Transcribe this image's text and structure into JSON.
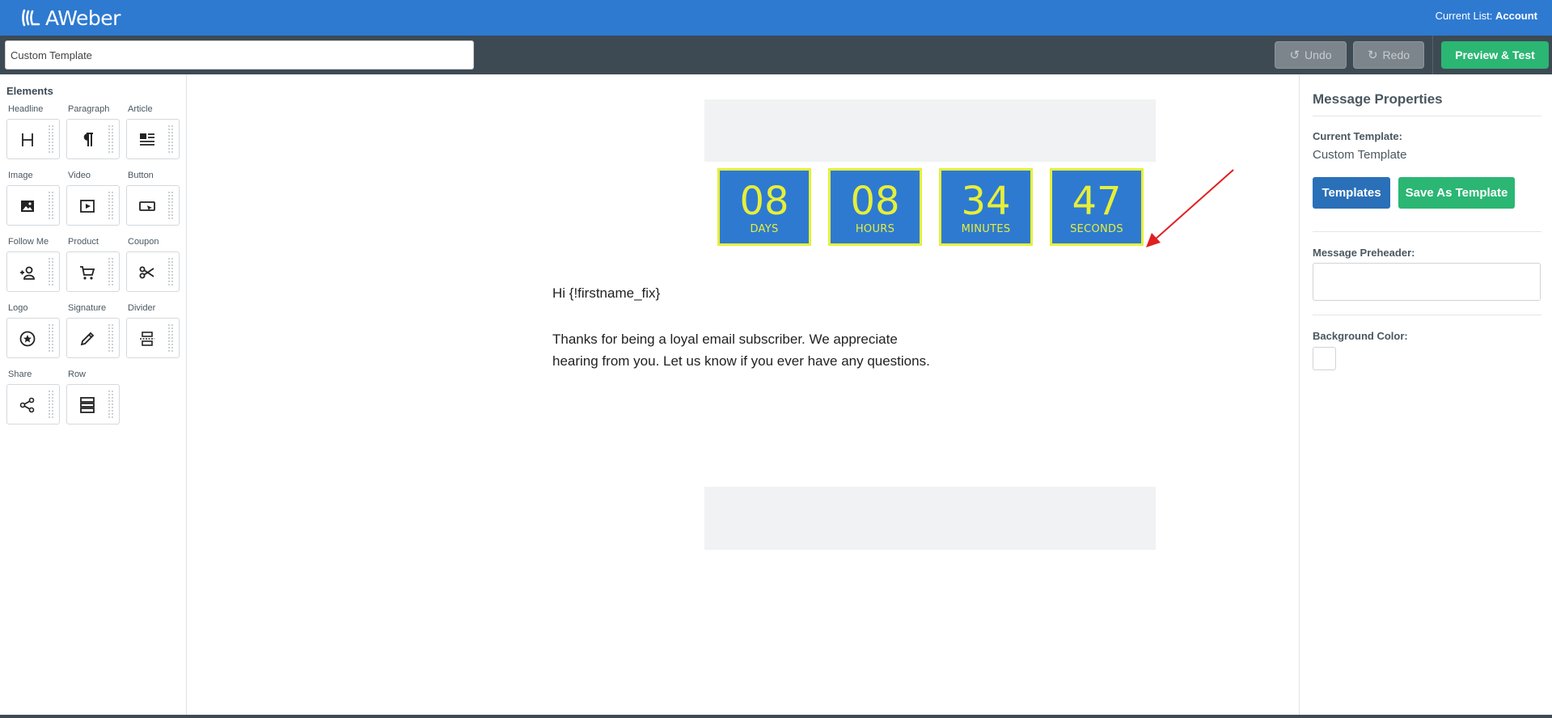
{
  "header": {
    "logo_text": "AWeber",
    "current_list_label": "Current List:",
    "current_list_value": "Account"
  },
  "toolbar": {
    "template_name_value": "Custom Template",
    "undo_label": "Undo",
    "redo_label": "Redo",
    "preview_label": "Preview & Test"
  },
  "sidebar": {
    "title": "Elements",
    "items": [
      {
        "label": "Headline",
        "icon": "headline-icon"
      },
      {
        "label": "Paragraph",
        "icon": "paragraph-icon"
      },
      {
        "label": "Article",
        "icon": "article-icon"
      },
      {
        "label": "Image",
        "icon": "image-icon"
      },
      {
        "label": "Video",
        "icon": "video-icon"
      },
      {
        "label": "Button",
        "icon": "button-icon"
      },
      {
        "label": "Follow Me",
        "icon": "follow-me-icon"
      },
      {
        "label": "Product",
        "icon": "cart-icon"
      },
      {
        "label": "Coupon",
        "icon": "scissors-icon"
      },
      {
        "label": "Logo",
        "icon": "star-circle-icon"
      },
      {
        "label": "Signature",
        "icon": "pencil-icon"
      },
      {
        "label": "Divider",
        "icon": "divider-icon"
      },
      {
        "label": "Share",
        "icon": "share-icon"
      },
      {
        "label": "Row",
        "icon": "row-icon"
      }
    ]
  },
  "canvas": {
    "countdown": [
      {
        "value": "08",
        "unit": "DAYS"
      },
      {
        "value": "08",
        "unit": "HOURS"
      },
      {
        "value": "34",
        "unit": "MINUTES"
      },
      {
        "value": "47",
        "unit": "SECONDS"
      }
    ],
    "greeting": "Hi {!firstname_fix}",
    "body": "Thanks for being a loyal email subscriber. We appreciate hearing from you. Let us know if you ever have any questions."
  },
  "properties": {
    "title": "Message Properties",
    "current_template_label": "Current Template:",
    "current_template_value": "Custom Template",
    "templates_button": "Templates",
    "save_as_template_button": "Save As Template",
    "preheader_label": "Message Preheader:",
    "background_color_label": "Background Color:",
    "background_color_value": "#ffffff"
  },
  "colors": {
    "brand_blue": "#2e7ad1",
    "toolbar_dark": "#3d4a54",
    "success_green": "#2bb673",
    "countdown_yellow": "#e6ef3a",
    "annotation_red": "#e02020"
  }
}
